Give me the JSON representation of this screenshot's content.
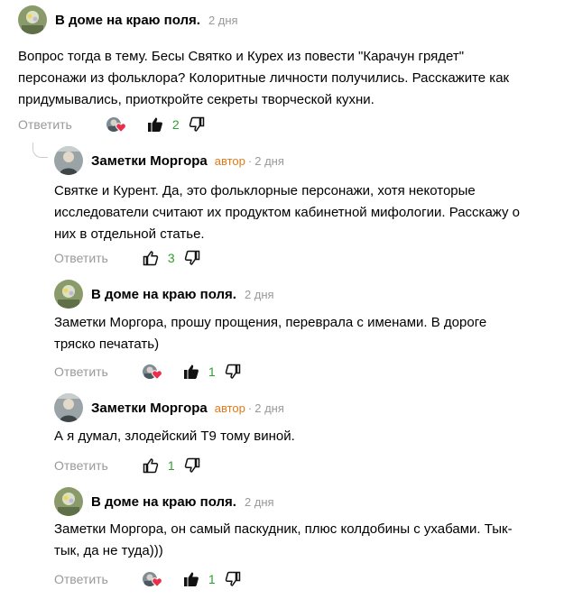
{
  "comments": [
    {
      "author": "В доме на краю поля.",
      "badge": "",
      "date": "2 дня",
      "text": "Вопрос тогда в тему. Бесы Святко и Курех из повести \"Карачун грядет\"\nперсонажи из фольклора? Колоритные личности получились. Расскажите как\nпридумывались, приоткройте секреты творческой кухни.",
      "reply_label": "Ответить",
      "likes": "2",
      "liked": true,
      "avatar_icon": "user-photo-flower",
      "reactor_icon": "reactor-avatar-heart"
    },
    {
      "author": "Заметки Моргора",
      "badge": "автор",
      "date": "2 дня",
      "text": "Святке и Курент. Да, это фольклорные персонажи, хотя некоторые\nисследователи считают их продуктом кабинетной мифологии. Расскажу о\nних в отдельной статье.",
      "reply_label": "Ответить",
      "likes": "3",
      "liked": false,
      "avatar_icon": "user-photo-person"
    },
    {
      "author": "В доме на краю поля.",
      "badge": "",
      "date": "2 дня",
      "text": "Заметки Моргора, прошу прощения, переврала с именами. В дороге\nтряско печатать)",
      "reply_label": "Ответить",
      "likes": "1",
      "liked": true,
      "avatar_icon": "user-photo-flower",
      "reactor_icon": "reactor-avatar-heart"
    },
    {
      "author": "Заметки Моргора",
      "badge": "автор",
      "date": "2 дня",
      "text": "А я думал, злодейский Т9 тому виной.",
      "reply_label": "Ответить",
      "likes": "1",
      "liked": false,
      "avatar_icon": "user-photo-person"
    },
    {
      "author": "В доме на краю поля.",
      "badge": "",
      "date": "2 дня",
      "text": "Заметки Моргора, он самый паскудник, плюс колдобины с ухабами. Тык-\nтык, да не туда)))",
      "reply_label": "Ответить",
      "likes": "1",
      "liked": true,
      "avatar_icon": "user-photo-flower",
      "reactor_icon": "reactor-avatar-heart"
    }
  ],
  "colors": {
    "author_badge": "#e07a16",
    "meta_gray": "#999999",
    "like_count": "#2ca02c",
    "heart": "#e8304a"
  }
}
